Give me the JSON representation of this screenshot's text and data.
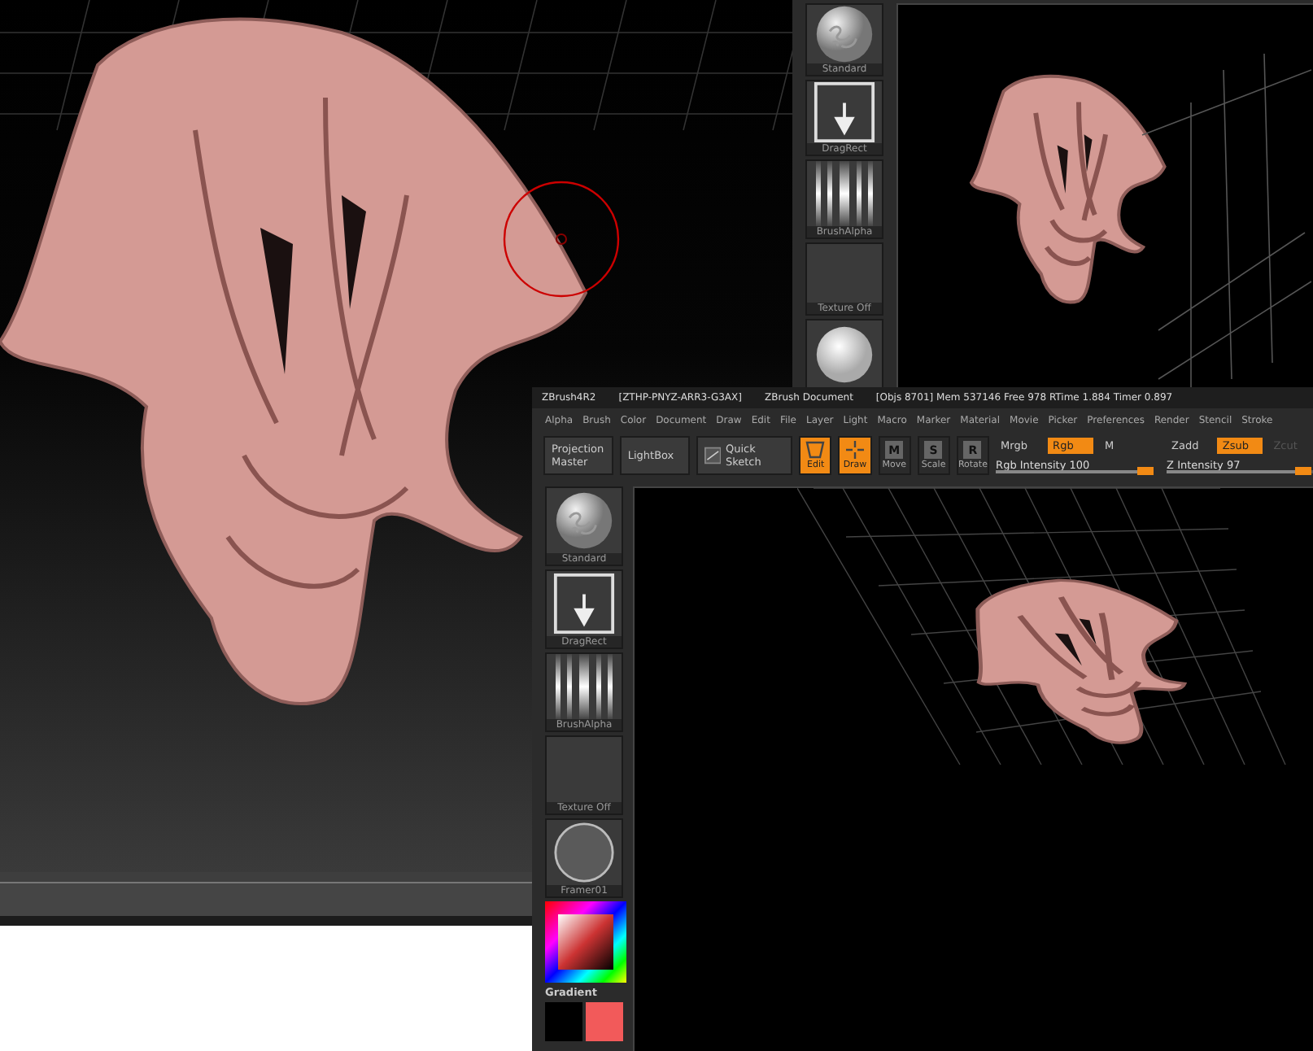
{
  "top_window": {
    "shelf": [
      {
        "kind": "brush",
        "label": "Standard"
      },
      {
        "kind": "stroke",
        "label": "DragRect"
      },
      {
        "kind": "alpha",
        "label": "BrushAlpha"
      },
      {
        "kind": "texture",
        "label": "Texture Off"
      },
      {
        "kind": "matcap"
      }
    ]
  },
  "main_window": {
    "title_bar": [
      "ZBrush4R2",
      "[ZTHP-PNYZ-ARR3-G3AX]",
      "ZBrush Document",
      "[Objs 8701] Mem 537146 Free 978 RTime 1.884 Timer 0.897"
    ],
    "menu": [
      "Alpha",
      "Brush",
      "Color",
      "Document",
      "Draw",
      "Edit",
      "File",
      "Layer",
      "Light",
      "Macro",
      "Marker",
      "Material",
      "Movie",
      "Picker",
      "Preferences",
      "Render",
      "Stencil",
      "Stroke"
    ],
    "toolbar": [
      {
        "kind": "text",
        "label": "Projection Master"
      },
      {
        "kind": "text",
        "label": "LightBox"
      },
      {
        "kind": "sketch",
        "label": "Quick Sketch"
      },
      {
        "kind": "edit",
        "label": "Edit",
        "selected": true
      },
      {
        "kind": "draw",
        "label": "Draw",
        "selected": true
      },
      {
        "kind": "key",
        "key": "M",
        "label": "Move",
        "selected": false
      },
      {
        "kind": "key",
        "key": "S",
        "label": "Scale",
        "selected": false
      },
      {
        "kind": "key",
        "key": "R",
        "label": "Rotate",
        "selected": false
      }
    ],
    "rgb_modes": [
      {
        "label": "Mrgb",
        "selected": false
      },
      {
        "label": "Rgb",
        "selected": true
      },
      {
        "label": "M",
        "selected": false
      }
    ],
    "rgb_intensity": {
      "label": "Rgb Intensity",
      "reading": "100",
      "level": 1.0
    },
    "z_modes": [
      {
        "label": "Zadd",
        "selected": false,
        "disabled": false
      },
      {
        "label": "Zsub",
        "selected": true,
        "disabled": false
      },
      {
        "label": "Zcut",
        "selected": false,
        "disabled": true
      }
    ],
    "z_intensity": {
      "label": "Z Intensity",
      "reading": "97",
      "level": 0.97
    },
    "shelf": [
      {
        "kind": "brush",
        "label": "Standard"
      },
      {
        "kind": "stroke",
        "label": "DragRect"
      },
      {
        "kind": "alpha",
        "label": "BrushAlpha"
      },
      {
        "kind": "texture",
        "label": "Texture Off"
      },
      {
        "kind": "ring",
        "label": "Framer01"
      }
    ],
    "gradient": {
      "label": "Gradient",
      "swatches": [
        {
          "color": "#000000"
        },
        {
          "color": "#f25a5a"
        }
      ]
    }
  }
}
